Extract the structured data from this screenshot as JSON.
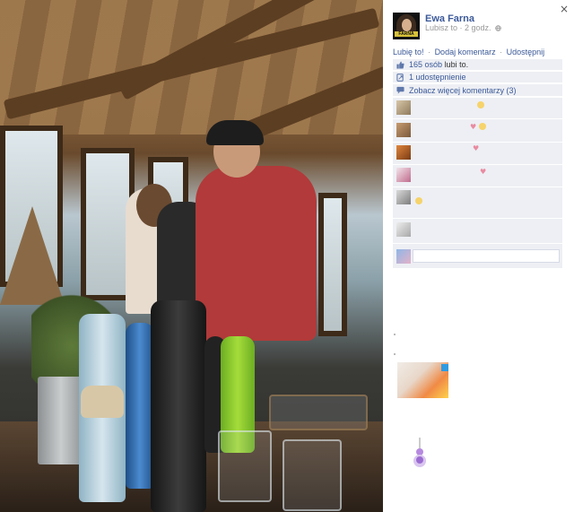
{
  "sidebar": {
    "close_glyph": "×",
    "poster_name": "Ewa Farna",
    "avatar_logo": "FARNA",
    "meta": "Lubisz to · 2 godz.",
    "globe_icon": "globe-icon",
    "actions": {
      "like": "Lubię to!",
      "comment": "Dodaj komentarz",
      "share": "Udostępnij",
      "separator": "·"
    },
    "likes": {
      "count": "165 osób",
      "suffix": "lubi to."
    },
    "shares": "1 udostępnienie",
    "more_comments": "Zobacz więcej komentarzy (3)",
    "comment_heart": "♥"
  },
  "colors": {
    "link": "#3b5998",
    "panel": "#edeff4",
    "heart": "#e98ba0"
  }
}
